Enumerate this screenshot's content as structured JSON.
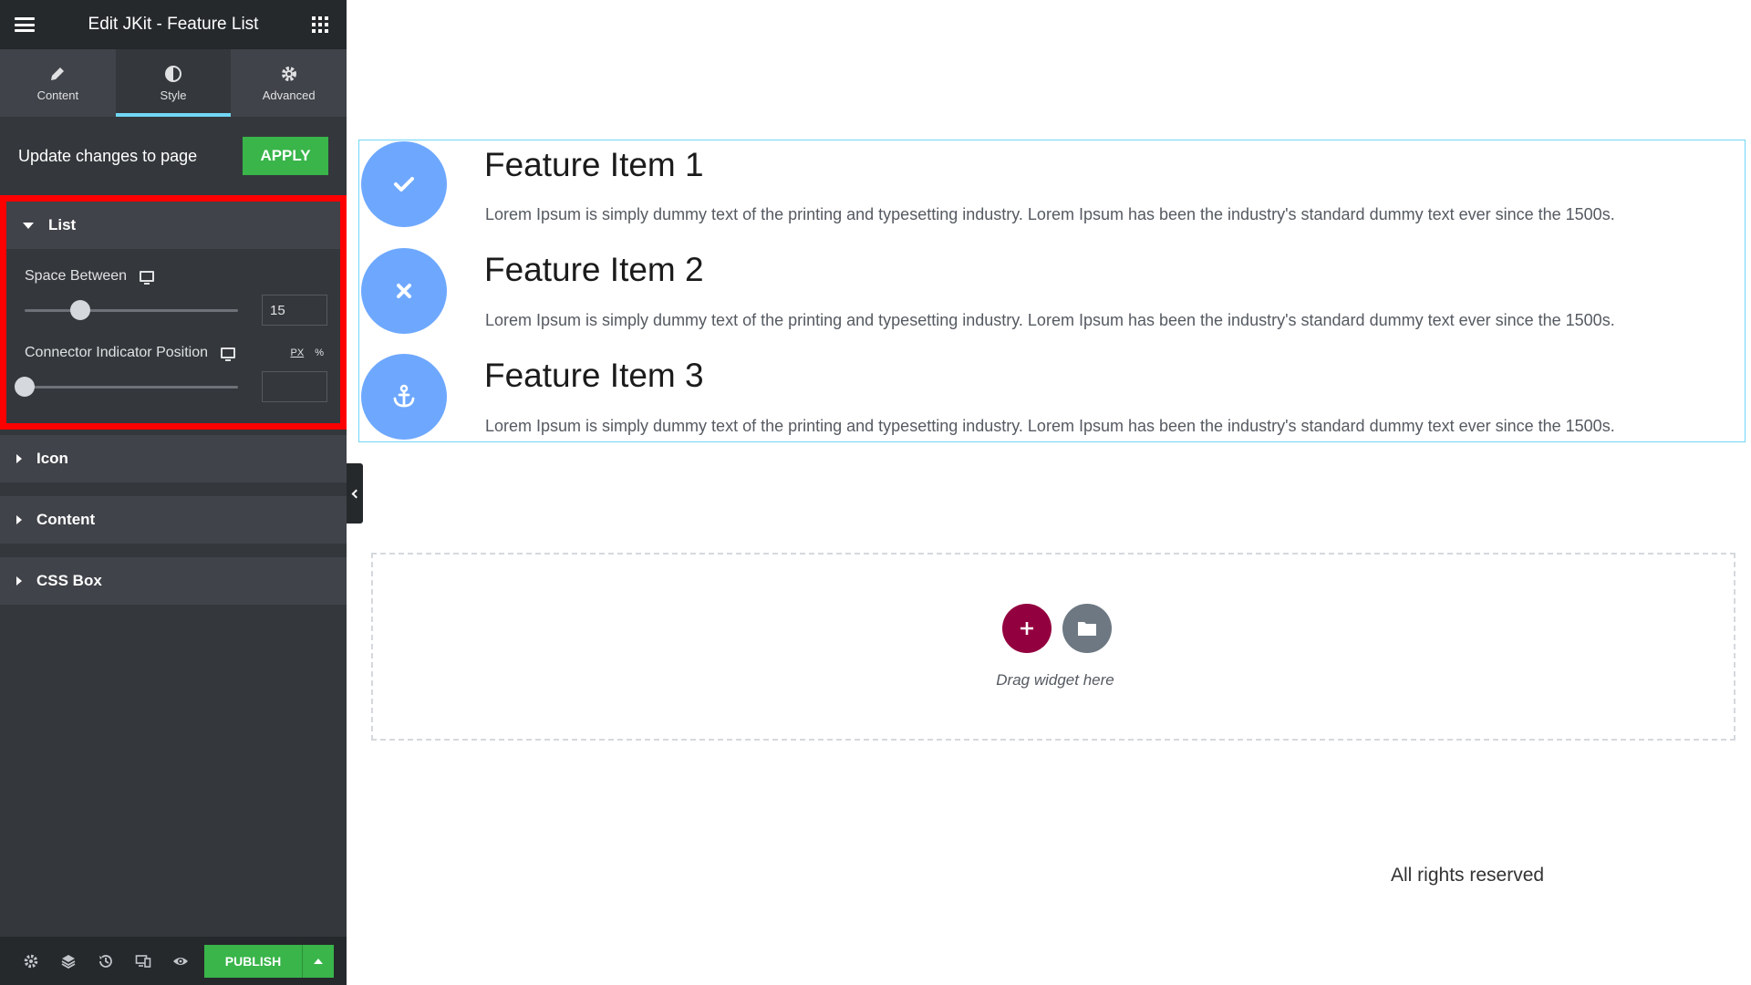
{
  "header": {
    "title": "Edit JKit - Feature List"
  },
  "tabs": [
    {
      "label": "Content",
      "icon": "pencil-icon"
    },
    {
      "label": "Style",
      "icon": "contrast-icon",
      "active": true
    },
    {
      "label": "Advanced",
      "icon": "gear-icon"
    }
  ],
  "apply_row": {
    "label": "Update changes to page",
    "button": "APPLY"
  },
  "list_section": {
    "title": "List",
    "space_between": {
      "label": "Space Between",
      "value": "15",
      "slider_fraction": 0.26
    },
    "connector": {
      "label": "Connector Indicator Position",
      "value": "",
      "slider_fraction": 0.0,
      "unit_px": "PX",
      "unit_pct": "%"
    }
  },
  "sections": [
    {
      "title": "Icon"
    },
    {
      "title": "Content"
    },
    {
      "title": "CSS Box"
    }
  ],
  "footer_bar": {
    "publish": "PUBLISH"
  },
  "features": [
    {
      "title": "Feature Item 1",
      "icon": "check-icon",
      "desc": "Lorem Ipsum is simply dummy text of the printing and typesetting industry. Lorem Ipsum has been the industry's standard dummy text ever since the 1500s."
    },
    {
      "title": "Feature Item 2",
      "icon": "close-icon",
      "desc": "Lorem Ipsum is simply dummy text of the printing and typesetting industry. Lorem Ipsum has been the industry's standard dummy text ever since the 1500s."
    },
    {
      "title": "Feature Item 3",
      "icon": "anchor-icon",
      "desc": "Lorem Ipsum is simply dummy text of the printing and typesetting industry. Lorem Ipsum has been the industry's standard dummy text ever since the 1500s."
    }
  ],
  "dropzone": {
    "text": "Drag widget here"
  },
  "page_footer": {
    "text": "All rights reserved"
  },
  "colors": {
    "accent_green": "#39b54a",
    "tab_underline": "#71d7f7",
    "icon_circle": "#6ea8fe",
    "add_button": "#93003f",
    "highlight": "#ff0000"
  }
}
